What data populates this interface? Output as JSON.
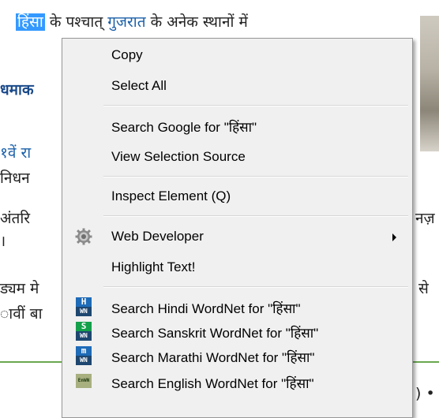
{
  "background": {
    "line1_selected": "हिंसा",
    "line1_pre": "के पश्चात्",
    "line1_link": "गुजरात",
    "line1_post": "के अनेक स्थानों में",
    "line2": "धमाक",
    "line3": "१वें रा",
    "line4": "निधन",
    "line5": "अंतरि",
    "line5_right": "नज़",
    "line6": "।",
    "line7": "ड्यम मे",
    "line7_right": "से",
    "line8": "ावीं बा",
    "bottom_right": ") •"
  },
  "menu": {
    "copy": "Copy",
    "select_all": "Select All",
    "search_google": "Search Google for \"हिंसा\"",
    "view_selection_source": "View Selection Source",
    "inspect_element": "Inspect Element (Q)",
    "web_developer": "Web Developer",
    "highlight_text": "Highlight Text!",
    "search_hindi": "Search Hindi WordNet for \"हिंसा\"",
    "search_sanskrit": "Search Sanskrit WordNet for \"हिंसा\"",
    "search_marathi": "Search Marathi WordNet for \"हिंसा\"",
    "search_english": "Search English WordNet for \"हिंसा\""
  },
  "icons": {
    "hindi_letter": "H",
    "sanskrit_letter": "S",
    "marathi_letter": "m",
    "wn": "WN",
    "english_tag": "EnWN"
  },
  "colors": {
    "selection": "#3399ff",
    "link": "#1a5fa8",
    "menu_bg": "#f0f0f0",
    "wn_hindi": "#1e6bb8",
    "wn_sanskrit": "#14a04a",
    "wn_marathi": "#1e6bb8",
    "wn_english": "#a8b080"
  }
}
